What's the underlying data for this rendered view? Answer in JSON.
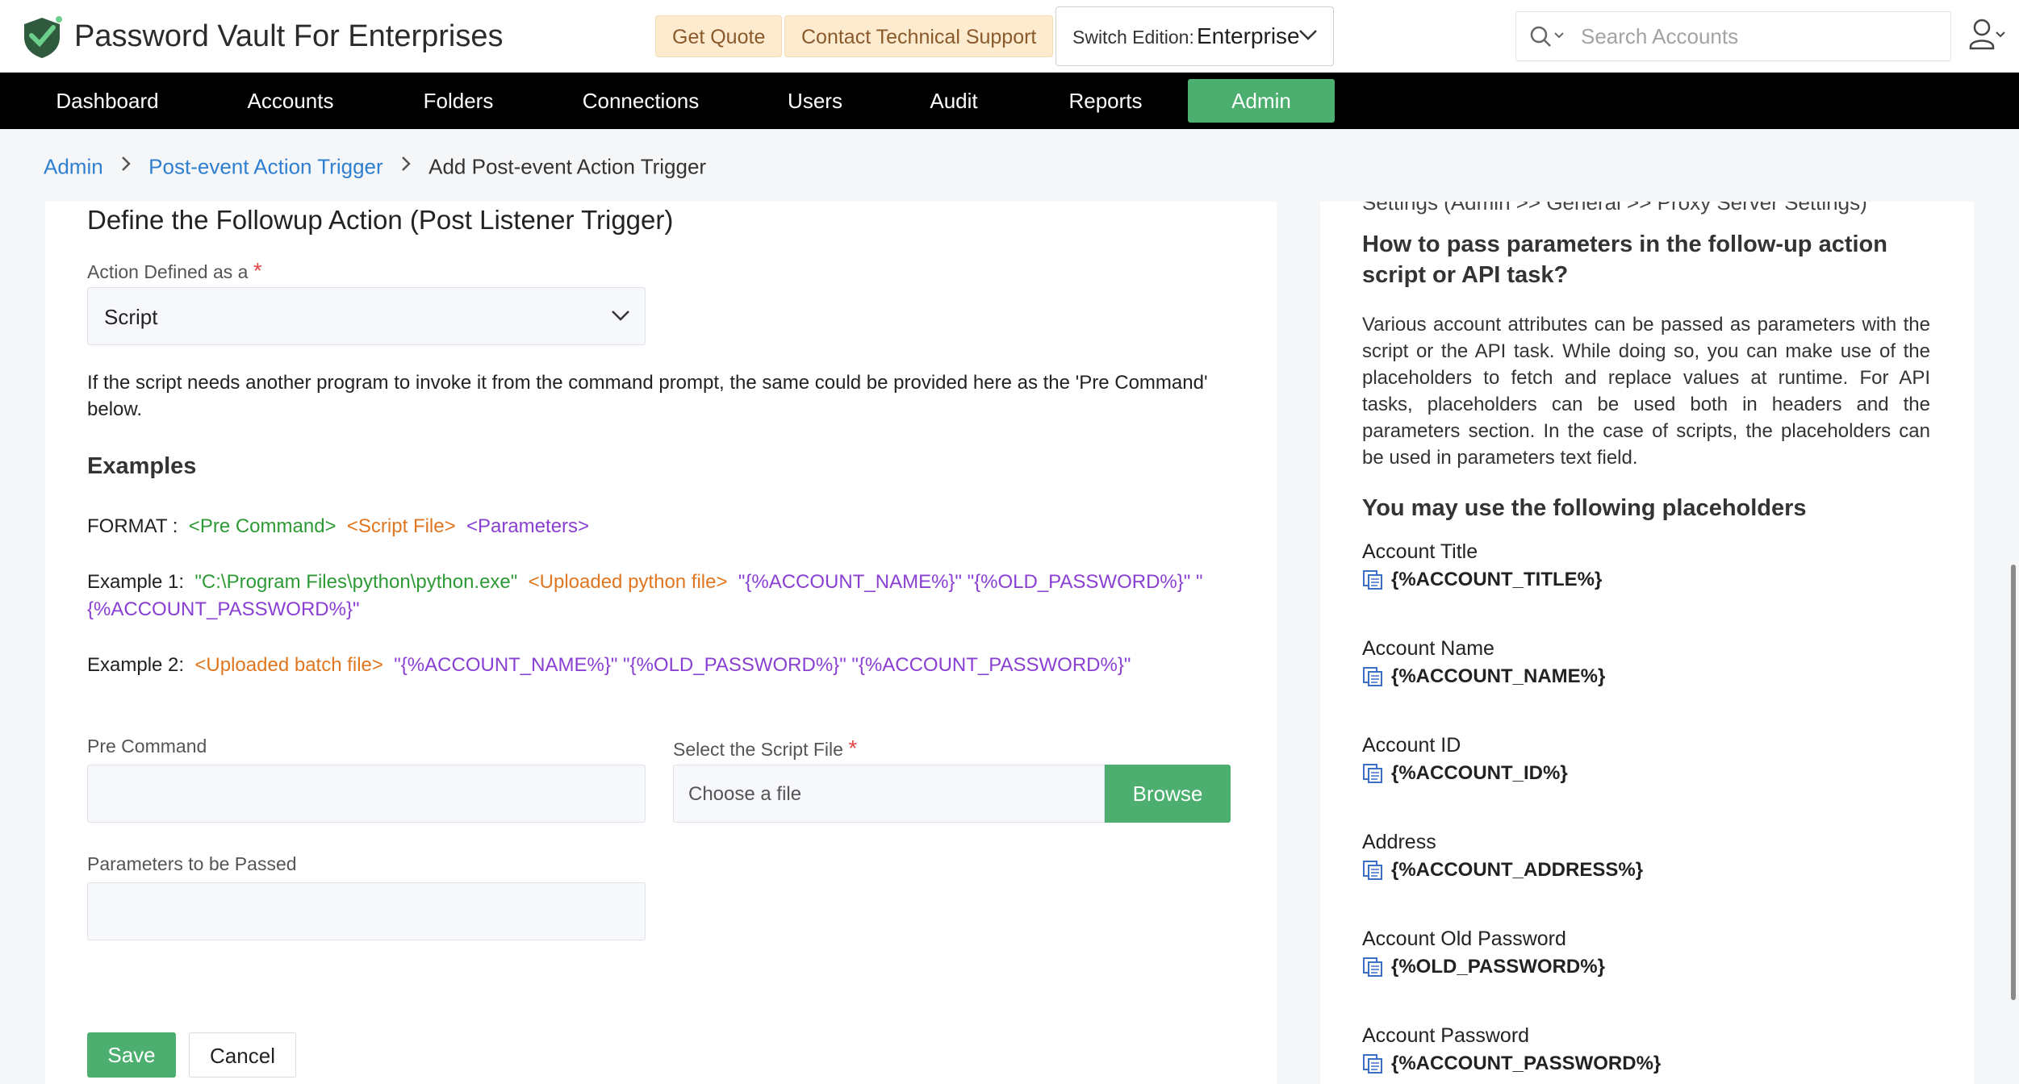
{
  "header": {
    "app_title": "Password Vault For Enterprises",
    "get_quote": "Get Quote",
    "contact_support": "Contact Technical Support",
    "edition_label": "Switch Edition:",
    "edition_value": "Enterprise",
    "search_placeholder": "Search Accounts"
  },
  "nav": {
    "items": [
      "Dashboard",
      "Accounts",
      "Folders",
      "Connections",
      "Users",
      "Audit",
      "Reports",
      "Admin"
    ],
    "active": "Admin"
  },
  "breadcrumb": {
    "root": "Admin",
    "parent": "Post-event Action Trigger",
    "current": "Add Post-event Action Trigger"
  },
  "form": {
    "title": "Define the Followup Action (Post Listener Trigger)",
    "action_label": "Action Defined as a",
    "action_value": "Script",
    "description": "If the script needs another program to invoke it from the command prompt, the same could be provided here as the 'Pre Command' below.",
    "examples_title": "Examples",
    "format_label": "FORMAT :",
    "format_pre": "<Pre Command>",
    "format_script": "<Script File>",
    "format_params": "<Parameters>",
    "ex1_label": "Example 1:",
    "ex1_pre": "\"C:\\Program Files\\python\\python.exe\"",
    "ex1_script": "<Uploaded python file>",
    "ex1_params": "\"{%ACCOUNT_NAME%}\" \"{%OLD_PASSWORD%}\" \"{%ACCOUNT_PASSWORD%}\"",
    "ex2_label": "Example 2:",
    "ex2_script": "<Uploaded batch file>",
    "ex2_params": "\"{%ACCOUNT_NAME%}\" \"{%OLD_PASSWORD%}\" \"{%ACCOUNT_PASSWORD%}\"",
    "pre_command_label": "Pre Command",
    "pre_command_value": "",
    "script_file_label": "Select the Script File",
    "script_file_placeholder": "Choose a file",
    "browse_label": "Browse",
    "params_label": "Parameters to be Passed",
    "params_value": "",
    "save_label": "Save",
    "cancel_label": "Cancel"
  },
  "help": {
    "cut_text": "Settings (Admin >> General >> Proxy Server Settings)",
    "heading": "How to pass parameters in the follow-up action script or API task?",
    "paragraph": "Various account attributes can be passed as parameters with the script or the API task. While doing so, you can make use of the placeholders to fetch and replace values at runtime. For API tasks, placeholders can be used both in headers and the parameters section. In the case of scripts, the placeholders can be used in parameters text field.",
    "placeholders_heading": "You may use the following placeholders",
    "placeholders": [
      {
        "label": "Account Title",
        "value": "{%ACCOUNT_TITLE%}"
      },
      {
        "label": "Account Name",
        "value": "{%ACCOUNT_NAME%}"
      },
      {
        "label": "Account ID",
        "value": "{%ACCOUNT_ID%}"
      },
      {
        "label": "Address",
        "value": "{%ACCOUNT_ADDRESS%}"
      },
      {
        "label": "Account Old Password",
        "value": "{%OLD_PASSWORD%}"
      },
      {
        "label": "Account Password",
        "value": "{%ACCOUNT_PASSWORD%}"
      }
    ]
  },
  "colors": {
    "accent_green": "#4caf70",
    "link_blue": "#2f7fd0",
    "nav_bg": "#000000",
    "pill_bg": "#fdebd0"
  }
}
